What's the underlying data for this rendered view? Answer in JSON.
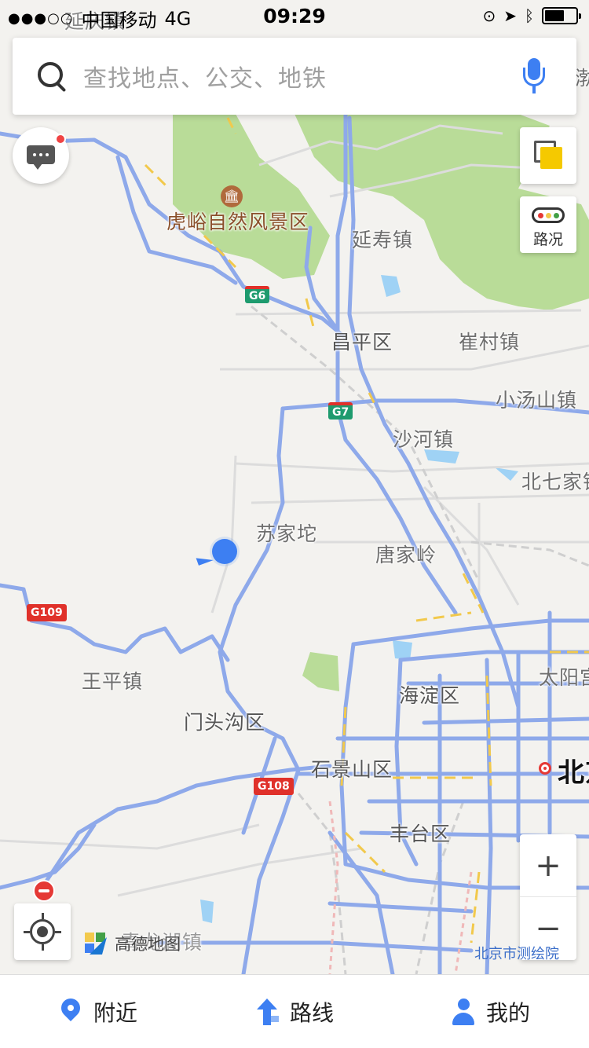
{
  "status_bar": {
    "signal": "●●●○○",
    "carrier": "中国移动",
    "network": "4G",
    "time": "09:29",
    "battery_level": 0.62
  },
  "search": {
    "placeholder": "查找地点、公交、地铁"
  },
  "controls": {
    "traffic_label": "路况",
    "zoom_in": "+",
    "zoom_out": "−"
  },
  "map": {
    "places": {
      "hujiashan": "虎峪自然风景区",
      "yanshou": "延寿镇",
      "changping": "昌平区",
      "cuicun": "崔村镇",
      "xiaotangshan": "小汤山镇",
      "shahe": "沙河镇",
      "beiqijia": "北七家镇",
      "sujiatuo": "苏家坨",
      "tangjialing": "唐家岭",
      "wangping": "王平镇",
      "mentougou": "门头沟区",
      "haidian": "海淀区",
      "taiyang": "太阳宫",
      "shijingshan": "石景山区",
      "beijing": "北京",
      "fengtai": "丰台区",
      "qinglong": "青龙湖镇",
      "top_partial": "延庆镇",
      "right_partial": "渤"
    },
    "roads": {
      "g6": "G6",
      "g7": "G7",
      "g109": "G109",
      "g108": "G108"
    },
    "brand": "高德地图",
    "copyright": "北京市测绘院"
  },
  "tabs": [
    {
      "label": "附近",
      "icon": "pin-icon"
    },
    {
      "label": "路线",
      "icon": "route-icon"
    },
    {
      "label": "我的",
      "icon": "user-icon"
    }
  ],
  "colors": {
    "accent": "#3d7ff2",
    "park_green": "#b9dc98",
    "water": "#9fd2f5",
    "road_blue": "#8ea9ea",
    "road_yellow": "#f2c94c",
    "alert_red": "#f04343"
  }
}
